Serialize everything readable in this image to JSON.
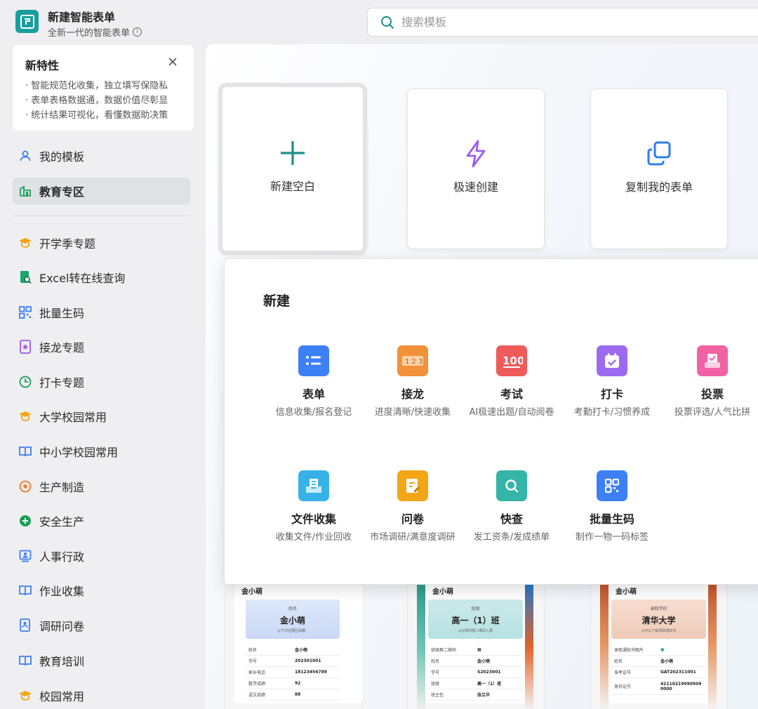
{
  "app": {
    "title": "新建智能表单",
    "subtitle": "全新一代的智能表单"
  },
  "search": {
    "placeholder": "搜索模板"
  },
  "new_features": {
    "title": "新特性",
    "lines": [
      "· 智能规范化收集，独立填写保隐私",
      "· 表单表格数据通，数据价值尽彰显",
      "· 统计结果可视化，看懂数据助决策"
    ]
  },
  "sidebar": {
    "top_items": [
      {
        "label": "我的模板",
        "icon": "user-icon"
      },
      {
        "label": "教育专区",
        "icon": "building-icon"
      }
    ],
    "items": [
      {
        "label": "开学季专题",
        "icon": "graduation-cap-icon"
      },
      {
        "label": "Excel转在线查询",
        "icon": "excel-search-icon"
      },
      {
        "label": "批量生码",
        "icon": "qr-code-icon"
      },
      {
        "label": "接龙专题",
        "icon": "star-doc-icon"
      },
      {
        "label": "打卡专题",
        "icon": "clock-icon"
      },
      {
        "label": "大学校园常用",
        "icon": "graduation-cap-icon"
      },
      {
        "label": "中小学校园常用",
        "icon": "book-icon"
      },
      {
        "label": "生产制造",
        "icon": "star-badge-icon"
      },
      {
        "label": "安全生产",
        "icon": "plus-circle-icon"
      },
      {
        "label": "人事行政",
        "icon": "person-board-icon"
      },
      {
        "label": "作业收集",
        "icon": "book-icon"
      },
      {
        "label": "调研问卷",
        "icon": "survey-icon"
      },
      {
        "label": "教育培训",
        "icon": "book-icon"
      },
      {
        "label": "校园常用",
        "icon": "graduation-cap-icon"
      }
    ]
  },
  "create_cards": [
    {
      "label": "新建空白",
      "icon": "plus-icon"
    },
    {
      "label": "极速创建",
      "icon": "lightning-icon"
    },
    {
      "label": "复制我的表单",
      "icon": "copy-icon"
    }
  ],
  "popup": {
    "title": "新建",
    "tiles": [
      {
        "title": "表单",
        "desc": "信息收集/报名登记",
        "icon": "form-list-icon",
        "color": "#3d7ff5"
      },
      {
        "title": "接龙",
        "desc": "进度清晰/快速收集",
        "icon": "number-sequence-icon",
        "color": "#f2913a"
      },
      {
        "title": "考试",
        "desc": "AI极速出题/自动阅卷",
        "icon": "score-100-icon",
        "color": "#ef5a5a"
      },
      {
        "title": "打卡",
        "desc": "考勤打卡/习惯养成",
        "icon": "calendar-check-icon",
        "color": "#9b6af0"
      },
      {
        "title": "投票",
        "desc": "投票评选/人气比拼",
        "icon": "ballot-box-icon",
        "color": "#f062a3"
      },
      {
        "title": "文件收集",
        "desc": "收集文件/作业回收",
        "icon": "file-tray-icon",
        "color": "#37b2e8"
      },
      {
        "title": "问卷",
        "desc": "市场调研/满意度调研",
        "icon": "questionnaire-icon",
        "color": "#f2a516"
      },
      {
        "title": "快查",
        "desc": "发工资条/发成绩单",
        "icon": "magnifier-icon",
        "color": "#35b4a8"
      },
      {
        "title": "批量生码",
        "desc": "制作一物一码标签",
        "icon": "qr-code-icon",
        "color": "#3d7ff5"
      }
    ]
  },
  "previews": [
    {
      "name": "金小萌",
      "banner_label": "姓名",
      "banner_value": "金小萌",
      "banner_hint": "◎下次还要回油橋 -",
      "rows": [
        [
          "姓名",
          "金小萌"
        ],
        [
          "学号",
          "202301001"
        ],
        [
          "家长电话",
          "18123456789"
        ],
        [
          "数学成绩",
          "92"
        ],
        [
          "语文成绩",
          "88"
        ]
      ]
    },
    {
      "name": "金小萌",
      "banner_label": "班级",
      "banner_value": "高一（1）班",
      "banner_hint": "◎记得扫描二维码入群",
      "rows": [
        [
          "班级群二维码",
          ""
        ],
        [
          "姓名",
          "金小萌"
        ],
        [
          "学号",
          "S2023001"
        ],
        [
          "班级",
          "高一（1）班"
        ],
        [
          "班主任",
          "张立华"
        ]
      ]
    },
    {
      "name": "金小萌",
      "banner_label": "录取学校",
      "banner_value": "清华大学",
      "banner_hint": "◎可以下载录取通知书",
      "rows": [
        [
          "录取通知书图片",
          ""
        ],
        [
          "姓名",
          "金小萌"
        ],
        [
          "准考证号",
          "GAT202311001"
        ],
        [
          "身份证号",
          "42110219990909 0000"
        ]
      ]
    }
  ]
}
